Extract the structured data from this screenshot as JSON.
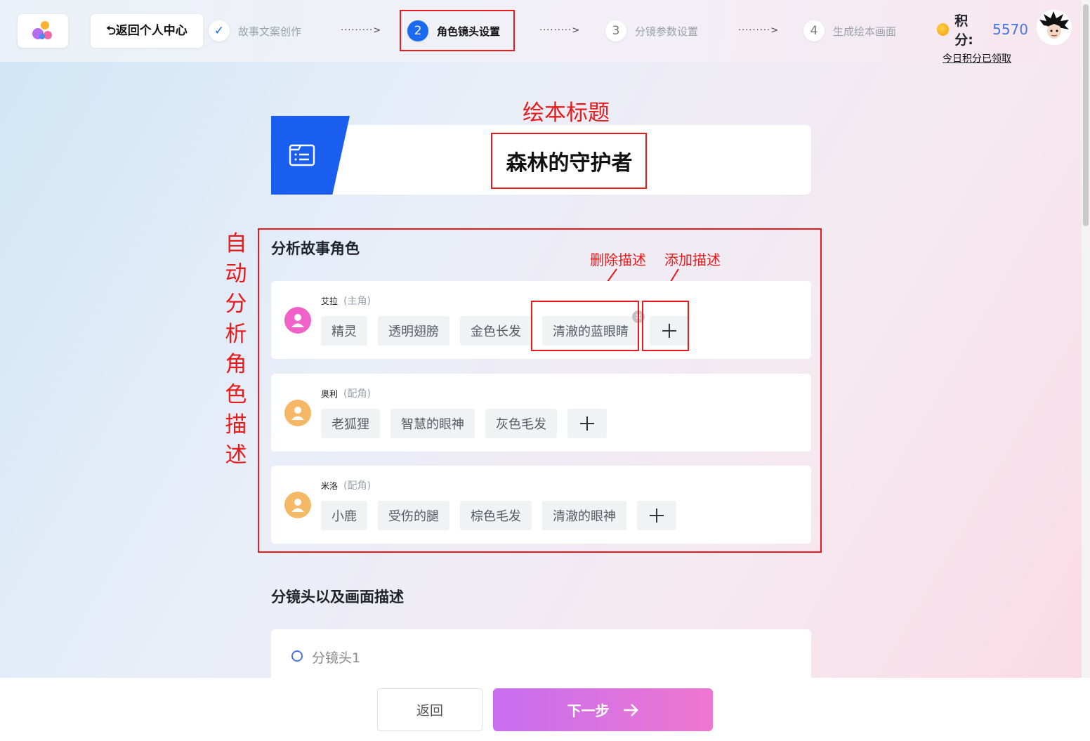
{
  "header": {
    "back_label": "⮌返回个人中心",
    "steps": [
      {
        "num": "✓",
        "label": "故事文案创作",
        "state": "done"
      },
      {
        "num": "2",
        "label": "角色镜头设置",
        "state": "active"
      },
      {
        "num": "3",
        "label": "分镜参数设置",
        "state": "pending"
      },
      {
        "num": "4",
        "label": "生成绘本画面",
        "state": "pending"
      }
    ],
    "step_separator": "·········>",
    "points_label": "积分:",
    "points_value": "5570",
    "claim_text": "今日积分已领取"
  },
  "annotations": {
    "title_note": "绘本标题",
    "section_note": "自动分析角色描述",
    "delete_note": "删除描述",
    "add_note": "添加描述"
  },
  "book": {
    "title": "森林的守护者"
  },
  "characters_section": {
    "heading": "分析故事角色",
    "characters": [
      {
        "name": "艾拉",
        "role": "(主角)",
        "avatar_color": "#f062c8",
        "tags": [
          "精灵",
          "透明翅膀",
          "金色长发",
          "清澈的蓝眼睛"
        ]
      },
      {
        "name": "奥利",
        "role": "(配角)",
        "avatar_color": "#f5b866",
        "tags": [
          "老狐狸",
          "智慧的眼神",
          "灰色毛发"
        ]
      },
      {
        "name": "米洛",
        "role": "(配角)",
        "avatar_color": "#f5b866",
        "tags": [
          "小鹿",
          "受伤的腿",
          "棕色毛发",
          "清澈的眼神"
        ]
      }
    ]
  },
  "shots_section": {
    "heading": "分镜头以及画面描述",
    "shots": [
      {
        "label": "分镜头1"
      }
    ]
  },
  "footer": {
    "back_label": "返回",
    "next_label": "下一步"
  },
  "colors": {
    "accent": "#1a6af0",
    "annotation": "#e81a1a",
    "next_gradient_start": "#c76ef0",
    "next_gradient_end": "#ee77cf"
  }
}
